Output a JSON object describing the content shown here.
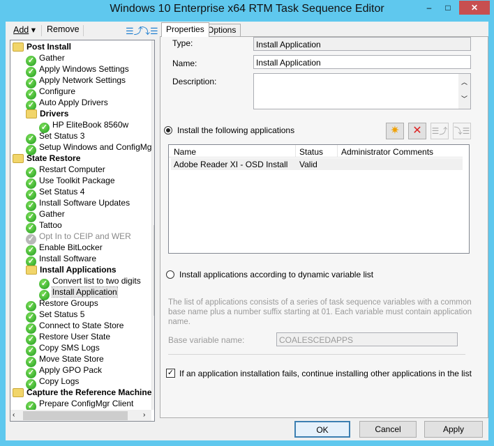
{
  "window": {
    "title": "Windows 10 Enterprise x64 RTM Task Sequence Editor",
    "minimize": "–",
    "maximize": "□",
    "close": "✕"
  },
  "toolbar": {
    "add": "Add",
    "remove": "Remove"
  },
  "tree": [
    {
      "label": "Post Install",
      "level": 0,
      "icon": "folder",
      "group": true
    },
    {
      "label": "Gather",
      "level": 1,
      "icon": "check"
    },
    {
      "label": "Apply Windows Settings",
      "level": 1,
      "icon": "check"
    },
    {
      "label": "Apply Network Settings",
      "level": 1,
      "icon": "check"
    },
    {
      "label": "Configure",
      "level": 1,
      "icon": "check"
    },
    {
      "label": "Auto Apply Drivers",
      "level": 1,
      "icon": "check"
    },
    {
      "label": "Drivers",
      "level": 1,
      "icon": "folder",
      "group": true
    },
    {
      "label": "HP EliteBook 8560w",
      "level": 2,
      "icon": "check"
    },
    {
      "label": "Set Status 3",
      "level": 1,
      "icon": "check"
    },
    {
      "label": "Setup Windows and ConfigMgr",
      "level": 1,
      "icon": "check"
    },
    {
      "label": "State Restore",
      "level": 0,
      "icon": "folder",
      "group": true
    },
    {
      "label": "Restart Computer",
      "level": 1,
      "icon": "check"
    },
    {
      "label": "Use Toolkit Package",
      "level": 1,
      "icon": "check"
    },
    {
      "label": "Set Status 4",
      "level": 1,
      "icon": "check"
    },
    {
      "label": "Install Software Updates",
      "level": 1,
      "icon": "check"
    },
    {
      "label": "Gather",
      "level": 1,
      "icon": "check"
    },
    {
      "label": "Tattoo",
      "level": 1,
      "icon": "check"
    },
    {
      "label": "Opt In to CEIP and WER",
      "level": 1,
      "icon": "disabled"
    },
    {
      "label": "Enable BitLocker",
      "level": 1,
      "icon": "check"
    },
    {
      "label": "Install Software",
      "level": 1,
      "icon": "check"
    },
    {
      "label": "Install Applications",
      "level": 1,
      "icon": "folder",
      "group": true
    },
    {
      "label": "Convert list to two digits",
      "level": 2,
      "icon": "check"
    },
    {
      "label": "Install Application",
      "level": 2,
      "icon": "check",
      "selected": true
    },
    {
      "label": "Restore Groups",
      "level": 1,
      "icon": "check"
    },
    {
      "label": "Set Status 5",
      "level": 1,
      "icon": "check"
    },
    {
      "label": "Connect to State Store",
      "level": 1,
      "icon": "check"
    },
    {
      "label": "Restore User State",
      "level": 1,
      "icon": "check"
    },
    {
      "label": "Copy SMS Logs",
      "level": 1,
      "icon": "check"
    },
    {
      "label": "Move State Store",
      "level": 1,
      "icon": "check"
    },
    {
      "label": "Apply GPO Pack",
      "level": 1,
      "icon": "check"
    },
    {
      "label": "Copy Logs",
      "level": 1,
      "icon": "check"
    },
    {
      "label": "Capture the Reference Machine",
      "level": 0,
      "icon": "folder",
      "group": true
    },
    {
      "label": "Prepare ConfigMgr Client",
      "level": 1,
      "icon": "check"
    }
  ],
  "tabs": {
    "properties": "Properties",
    "options": "Options"
  },
  "props": {
    "type_label": "Type:",
    "type_value": "Install Application",
    "name_label": "Name:",
    "name_value": "Install Application",
    "desc_label": "Description:",
    "desc_value": "",
    "radio1": "Install the following applications",
    "list_headers": [
      "Name",
      "Status",
      "Administrator Comments"
    ],
    "list_rows": [
      [
        "Adobe Reader XI - OSD Install",
        "Valid",
        ""
      ]
    ],
    "radio2": "Install applications according to dynamic variable list",
    "help_text": "The list of applications consists of a series of task sequence variables with a common base name plus a number suffix starting at 01.  Each variable must contain application name.",
    "base_label": "Base variable name:",
    "base_value": "COALESCEDAPPS",
    "checkbox": "If an application installation fails, continue installing other applications in the list"
  },
  "buttons": {
    "ok": "OK",
    "cancel": "Cancel",
    "apply": "Apply"
  }
}
